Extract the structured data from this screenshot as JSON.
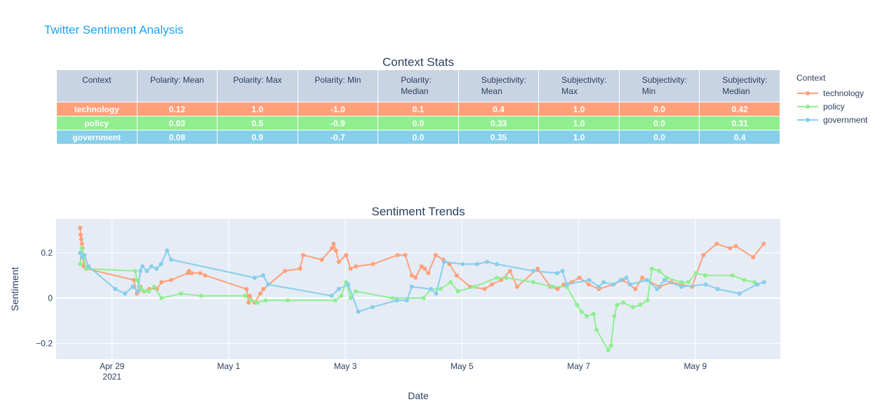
{
  "page": {
    "title": "Twitter Sentiment Analysis"
  },
  "table": {
    "title": "Context Stats",
    "headers": [
      "Context",
      "Polarity: Mean",
      "Polarity: Max",
      "Polarity: Min",
      "Polarity:\nMedian",
      "Subjectivity:\nMean",
      "Subjectivity:\nMax",
      "Subjectivity:\nMin",
      "Subjectivity:\nMedian"
    ],
    "rows": [
      [
        "technology",
        "0.12",
        "1.0",
        "-1.0",
        "0.1",
        "0.4",
        "1.0",
        "0.0",
        "0.42"
      ],
      [
        "policy",
        "0.03",
        "0.5",
        "-0.9",
        "0.0",
        "0.33",
        "1.0",
        "0.0",
        "0.31"
      ],
      [
        "government",
        "0.08",
        "0.9",
        "-0.7",
        "0.0",
        "0.35",
        "1.0",
        "0.0",
        "0.4"
      ]
    ]
  },
  "legend": {
    "title": "Context",
    "items": [
      "technology",
      "policy",
      "government"
    ]
  },
  "colors": {
    "technology": "#ffa07a",
    "policy": "#90ee90",
    "government": "#87ceeb",
    "plot_bg": "#e5ecf6",
    "grid": "#ffffff",
    "text": "#2a3f5f",
    "title": "#1da1f2"
  },
  "chart_data": [
    {
      "type": "table",
      "title": "Context Stats",
      "columns": [
        "Context",
        "Polarity: Mean",
        "Polarity: Max",
        "Polarity: Min",
        "Polarity: Median",
        "Subjectivity: Mean",
        "Subjectivity: Max",
        "Subjectivity: Min",
        "Subjectivity: Median"
      ],
      "rows": [
        [
          "technology",
          0.12,
          1.0,
          -1.0,
          0.1,
          0.4,
          1.0,
          0.0,
          0.42
        ],
        [
          "policy",
          0.03,
          0.5,
          -0.9,
          0.0,
          0.33,
          1.0,
          0.0,
          0.31
        ],
        [
          "government",
          0.08,
          0.9,
          -0.7,
          0.0,
          0.35,
          1.0,
          0.0,
          0.4
        ]
      ]
    },
    {
      "type": "line",
      "title": "Sentiment Trends",
      "xlabel": "Date",
      "ylabel": "Sentiment",
      "x_ticks": [
        [
          "2021-04-29",
          "Apr 29\n2021"
        ],
        [
          "2021-05-01",
          "May 1"
        ],
        [
          "2021-05-03",
          "May 3"
        ],
        [
          "2021-05-05",
          "May 5"
        ],
        [
          "2021-05-07",
          "May 7"
        ],
        [
          "2021-05-09",
          "May 9"
        ]
      ],
      "y_ticks": [
        -0.2,
        0,
        0.2
      ],
      "xlim": [
        "2021-04-28T01:00",
        "2021-05-10T11:00"
      ],
      "ylim": [
        -0.27,
        0.35
      ],
      "grid": true,
      "legend_position": "top-right",
      "series": [
        {
          "name": "technology",
          "points": [
            [
              "2021-04-28T10:55",
              0.31
            ],
            [
              "2021-04-28T11:05",
              0.28
            ],
            [
              "2021-04-28T11:20",
              0.26
            ],
            [
              "2021-04-28T11:35",
              0.24
            ],
            [
              "2021-04-28T11:50",
              0.22
            ],
            [
              "2021-04-28T12:20",
              0.14
            ],
            [
              "2021-04-28T13:30",
              0.13
            ],
            [
              "2021-04-29T09:00",
              0.08
            ],
            [
              "2021-04-29T10:10",
              0.02
            ],
            [
              "2021-04-29T10:50",
              0.03
            ],
            [
              "2021-04-29T11:40",
              0.05
            ],
            [
              "2021-04-29T13:10",
              0.03
            ],
            [
              "2021-04-29T15:20",
              0.04
            ],
            [
              "2021-04-29T18:30",
              0.04
            ],
            [
              "2021-04-29T20:20",
              0.07
            ],
            [
              "2021-04-30T00:20",
              0.08
            ],
            [
              "2021-04-30T07:10",
              0.11
            ],
            [
              "2021-04-30T07:40",
              0.12
            ],
            [
              "2021-04-30T08:50",
              0.11
            ],
            [
              "2021-04-30T12:20",
              0.11
            ],
            [
              "2021-04-30T14:20",
              0.1
            ],
            [
              "2021-05-01T07:20",
              0.04
            ],
            [
              "2021-05-01T08:10",
              -0.02
            ],
            [
              "2021-05-01T08:40",
              0.01
            ],
            [
              "2021-05-01T10:40",
              -0.02
            ],
            [
              "2021-05-01T13:00",
              0.02
            ],
            [
              "2021-05-01T14:20",
              0.04
            ],
            [
              "2021-05-01T23:10",
              0.12
            ],
            [
              "2021-05-02T05:20",
              0.13
            ],
            [
              "2021-05-02T06:40",
              0.19
            ],
            [
              "2021-05-02T14:20",
              0.17
            ],
            [
              "2021-05-02T18:30",
              0.22
            ],
            [
              "2021-05-02T19:10",
              0.24
            ],
            [
              "2021-05-02T20:10",
              0.21
            ],
            [
              "2021-05-02T21:20",
              0.16
            ],
            [
              "2021-05-03T00:20",
              0.19
            ],
            [
              "2021-05-03T02:10",
              0.13
            ],
            [
              "2021-05-03T04:20",
              0.14
            ],
            [
              "2021-05-03T11:20",
              0.15
            ],
            [
              "2021-05-03T21:30",
              0.19
            ],
            [
              "2021-05-04T00:40",
              0.19
            ],
            [
              "2021-05-04T03:20",
              0.1
            ],
            [
              "2021-05-04T04:50",
              0.09
            ],
            [
              "2021-05-04T07:20",
              0.14
            ],
            [
              "2021-05-04T08:40",
              0.13
            ],
            [
              "2021-05-04T10:10",
              0.11
            ],
            [
              "2021-05-04T13:10",
              0.19
            ],
            [
              "2021-05-04T16:20",
              0.17
            ],
            [
              "2021-05-04T18:50",
              0.15
            ],
            [
              "2021-05-04T21:50",
              0.1
            ],
            [
              "2021-05-05T03:20",
              0.05
            ],
            [
              "2021-05-05T09:20",
              0.04
            ],
            [
              "2021-05-05T12:20",
              0.06
            ],
            [
              "2021-05-05T16:10",
              0.08
            ],
            [
              "2021-05-05T19:50",
              0.12
            ],
            [
              "2021-05-05T22:40",
              0.05
            ],
            [
              "2021-05-06T07:10",
              0.13
            ],
            [
              "2021-05-06T12:20",
              0.05
            ],
            [
              "2021-05-06T15:20",
              0.04
            ],
            [
              "2021-05-06T17:50",
              0.06
            ],
            [
              "2021-05-06T21:10",
              0.07
            ],
            [
              "2021-05-07T00:20",
              0.09
            ],
            [
              "2021-05-07T04:10",
              0.06
            ],
            [
              "2021-05-07T08:20",
              0.04
            ],
            [
              "2021-05-07T14:20",
              0.06
            ],
            [
              "2021-05-07T18:10",
              0.08
            ],
            [
              "2021-05-07T23:20",
              0.04
            ],
            [
              "2021-05-08T02:10",
              0.09
            ],
            [
              "2021-05-08T09:20",
              0.05
            ],
            [
              "2021-05-08T14:10",
              0.07
            ],
            [
              "2021-05-08T18:20",
              0.06
            ],
            [
              "2021-05-08T22:40",
              0.05
            ],
            [
              "2021-05-09T03:20",
              0.19
            ],
            [
              "2021-05-09T08:50",
              0.24
            ],
            [
              "2021-05-09T14:20",
              0.22
            ],
            [
              "2021-05-09T16:40",
              0.23
            ],
            [
              "2021-05-09T23:50",
              0.18
            ],
            [
              "2021-05-10T04:10",
              0.24
            ]
          ]
        },
        {
          "name": "policy",
          "points": [
            [
              "2021-04-28T10:55",
              0.15
            ],
            [
              "2021-04-28T11:30",
              0.22
            ],
            [
              "2021-04-28T12:20",
              0.19
            ],
            [
              "2021-04-28T13:20",
              0.13
            ],
            [
              "2021-04-29T09:30",
              0.12
            ],
            [
              "2021-04-29T10:20",
              0.08
            ],
            [
              "2021-04-29T11:10",
              0.05
            ],
            [
              "2021-04-29T12:00",
              0.04
            ],
            [
              "2021-04-29T13:30",
              0.03
            ],
            [
              "2021-04-29T15:10",
              0.03
            ],
            [
              "2021-04-29T17:20",
              0.05
            ],
            [
              "2021-04-29T20:20",
              0.0
            ],
            [
              "2021-04-30T04:20",
              0.02
            ],
            [
              "2021-04-30T12:40",
              0.01
            ],
            [
              "2021-05-01T06:40",
              0.01
            ],
            [
              "2021-05-01T09:20",
              -0.01
            ],
            [
              "2021-05-01T11:40",
              -0.02
            ],
            [
              "2021-05-01T15:10",
              -0.01
            ],
            [
              "2021-05-02T00:20",
              -0.01
            ],
            [
              "2021-05-02T19:50",
              -0.01
            ],
            [
              "2021-05-02T22:20",
              0.01
            ],
            [
              "2021-05-03T00:20",
              0.07
            ],
            [
              "2021-05-03T02:10",
              0.0
            ],
            [
              "2021-05-03T04:20",
              0.03
            ],
            [
              "2021-05-03T19:20",
              0.0
            ],
            [
              "2021-05-04T08:10",
              0.0
            ],
            [
              "2021-05-04T11:20",
              0.04
            ],
            [
              "2021-05-04T15:10",
              0.04
            ],
            [
              "2021-05-04T19:20",
              0.07
            ],
            [
              "2021-05-04T22:20",
              0.03
            ],
            [
              "2021-05-05T05:10",
              0.05
            ],
            [
              "2021-05-05T14:20",
              0.09
            ],
            [
              "2021-05-05T18:10",
              0.09
            ],
            [
              "2021-05-06T05:20",
              0.07
            ],
            [
              "2021-05-06T13:20",
              0.05
            ],
            [
              "2021-05-06T19:10",
              0.05
            ],
            [
              "2021-05-06T23:20",
              -0.03
            ],
            [
              "2021-05-07T01:10",
              -0.06
            ],
            [
              "2021-05-07T03:20",
              -0.08
            ],
            [
              "2021-05-07T06:10",
              -0.07
            ],
            [
              "2021-05-07T07:20",
              -0.14
            ],
            [
              "2021-05-07T12:10",
              -0.23
            ],
            [
              "2021-05-07T13:20",
              -0.21
            ],
            [
              "2021-05-07T14:40",
              -0.08
            ],
            [
              "2021-05-07T15:50",
              -0.03
            ],
            [
              "2021-05-07T18:20",
              -0.02
            ],
            [
              "2021-05-07T22:20",
              -0.04
            ],
            [
              "2021-05-08T01:20",
              -0.03
            ],
            [
              "2021-05-08T04:20",
              -0.01
            ],
            [
              "2021-05-08T06:10",
              0.13
            ],
            [
              "2021-05-08T09:10",
              0.12
            ],
            [
              "2021-05-08T12:20",
              0.09
            ],
            [
              "2021-05-08T18:20",
              0.07
            ],
            [
              "2021-05-08T21:10",
              0.07
            ],
            [
              "2021-05-09T00:20",
              0.11
            ],
            [
              "2021-05-09T04:10",
              0.1
            ],
            [
              "2021-05-09T15:20",
              0.1
            ],
            [
              "2021-05-09T20:10",
              0.08
            ],
            [
              "2021-05-10T00:20",
              0.07
            ],
            [
              "2021-05-10T01:40",
              0.06
            ]
          ]
        },
        {
          "name": "government",
          "points": [
            [
              "2021-04-28T10:55",
              0.2
            ],
            [
              "2021-04-28T11:40",
              0.18
            ],
            [
              "2021-04-28T12:40",
              0.19
            ],
            [
              "2021-04-28T14:20",
              0.14
            ],
            [
              "2021-04-29T01:20",
              0.04
            ],
            [
              "2021-04-29T05:20",
              0.02
            ],
            [
              "2021-04-29T08:30",
              0.05
            ],
            [
              "2021-04-29T10:40",
              0.03
            ],
            [
              "2021-04-29T11:40",
              0.12
            ],
            [
              "2021-04-29T12:30",
              0.14
            ],
            [
              "2021-04-29T14:20",
              0.12
            ],
            [
              "2021-04-29T16:10",
              0.14
            ],
            [
              "2021-04-29T18:20",
              0.13
            ],
            [
              "2021-04-29T20:10",
              0.15
            ],
            [
              "2021-04-29T22:40",
              0.21
            ],
            [
              "2021-04-30T00:20",
              0.17
            ],
            [
              "2021-05-01T10:40",
              0.09
            ],
            [
              "2021-05-01T14:10",
              0.1
            ],
            [
              "2021-05-01T16:20",
              0.06
            ],
            [
              "2021-05-02T18:20",
              0.01
            ],
            [
              "2021-05-02T21:20",
              0.04
            ],
            [
              "2021-05-03T01:10",
              0.06
            ],
            [
              "2021-05-03T05:20",
              -0.06
            ],
            [
              "2021-05-03T11:10",
              -0.04
            ],
            [
              "2021-05-03T21:10",
              -0.01
            ],
            [
              "2021-05-04T01:20",
              -0.01
            ],
            [
              "2021-05-04T03:20",
              0.05
            ],
            [
              "2021-05-04T11:10",
              0.04
            ],
            [
              "2021-05-04T13:20",
              0.02
            ],
            [
              "2021-05-04T16:40",
              0.16
            ],
            [
              "2021-05-05T00:20",
              0.15
            ],
            [
              "2021-05-05T06:10",
              0.15
            ],
            [
              "2021-05-05T10:20",
              0.16
            ],
            [
              "2021-05-05T14:20",
              0.15
            ],
            [
              "2021-05-06T05:20",
              0.12
            ],
            [
              "2021-05-06T15:10",
              0.11
            ],
            [
              "2021-05-06T17:20",
              0.12
            ],
            [
              "2021-05-06T19:10",
              0.06
            ],
            [
              "2021-05-07T04:20",
              0.08
            ],
            [
              "2021-05-07T08:20",
              0.05
            ],
            [
              "2021-05-07T10:20",
              0.07
            ],
            [
              "2021-05-07T14:10",
              0.06
            ],
            [
              "2021-05-07T17:20",
              0.08
            ],
            [
              "2021-05-07T19:40",
              0.09
            ],
            [
              "2021-05-07T21:10",
              0.06
            ],
            [
              "2021-05-08T04:10",
              0.08
            ],
            [
              "2021-05-08T08:20",
              0.04
            ],
            [
              "2021-05-08T11:20",
              0.08
            ],
            [
              "2021-05-08T18:20",
              0.05
            ],
            [
              "2021-05-09T04:20",
              0.06
            ],
            [
              "2021-05-09T09:10",
              0.04
            ],
            [
              "2021-05-09T18:10",
              0.02
            ],
            [
              "2021-05-10T01:20",
              0.06
            ],
            [
              "2021-05-10T04:20",
              0.07
            ]
          ]
        }
      ]
    }
  ]
}
